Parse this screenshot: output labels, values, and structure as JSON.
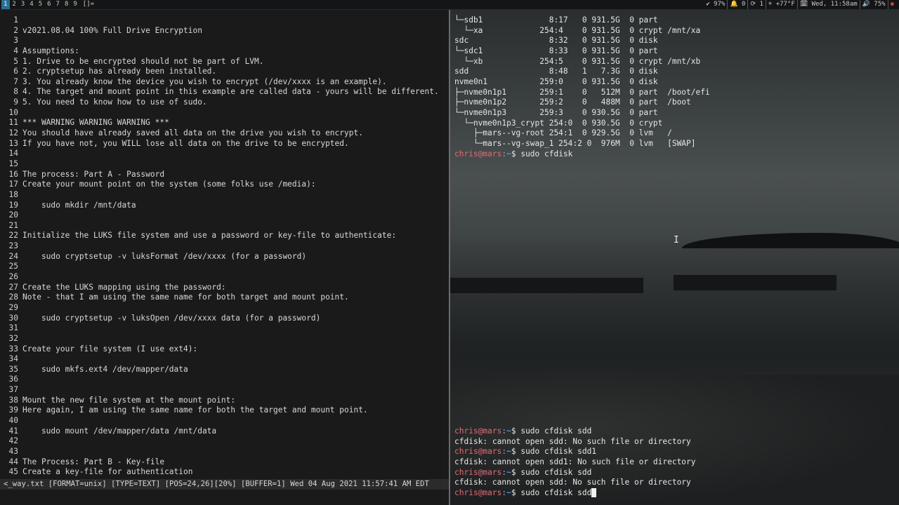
{
  "topbar": {
    "workspaces": [
      {
        "label": "1",
        "active": true
      },
      {
        "label": "2",
        "active": false
      },
      {
        "label": "3",
        "active": false
      },
      {
        "label": "4",
        "active": false
      },
      {
        "label": "5",
        "active": false
      },
      {
        "label": "6",
        "active": false
      },
      {
        "label": "7",
        "active": false
      },
      {
        "label": "8",
        "active": false
      },
      {
        "label": "9",
        "active": false
      }
    ],
    "layout": "[]=",
    "status": {
      "battery_pct": "✔ 97%",
      "notify": "🔔 0",
      "updates": "⟳ 1",
      "weather": "☀ +77°F",
      "datetime": "🗓 Wed, 11:58am",
      "volume": "🔊 75%"
    },
    "red_icon": "◉",
    "accent": "#2c6e8f"
  },
  "vim": {
    "lines": [
      "",
      "v2021.08.04 100% Full Drive Encryption",
      "",
      "Assumptions:",
      "1. Drive to be encrypted should not be part of LVM.",
      "2. cryptsetup has already been installed.",
      "3. You already know the device you wish to encrypt (/dev/xxxx is an example).",
      "4. The target and mount point in this example are called data - yours will be different.",
      "5. You need to know how to use of sudo.",
      "",
      "*** WARNING WARNING WARNING ***",
      "You should have already saved all data on the drive you wish to encrypt.",
      "If you have not, you WILL lose all data on the drive to be encrypted.",
      "",
      "",
      "The process: Part A - Password",
      "Create your mount point on the system (some folks use /media):",
      "",
      "    sudo mkdir /mnt/data",
      "",
      "",
      "Initialize the LUKS file system and use a password or key-file to authenticate:",
      "",
      "    sudo cryptsetup -v luksFormat /dev/xxxx (for a password)",
      "",
      "",
      "Create the LUKS mapping using the password:",
      "Note - that I am using the same name for both target and mount point.",
      "",
      "    sudo cryptsetup -v luksOpen /dev/xxxx data (for a password)",
      "",
      "",
      "Create your file system (I use ext4):",
      "",
      "    sudo mkfs.ext4 /dev/mapper/data",
      "",
      "",
      "Mount the new file system at the mount point:",
      "Here again, I am using the same name for both the target and mount point.",
      "",
      "    sudo mount /dev/mapper/data /mnt/data",
      "",
      "",
      "The Process: Part B - Key-file",
      "Create a key-file for authentication"
    ],
    "status_line": "<_way.txt [FORMAT=unix] [TYPE=TEXT] [POS=24,26][20%] [BUFFER=1] Wed 04 Aug 2021 11:57:41 AM EDT"
  },
  "terminal": {
    "prompt_user": "chris@mars",
    "prompt_path": ":~",
    "prompt_symbol": "$",
    "lsblk_rows": [
      "└─sdb1              8:17   0 931.5G  0 part",
      "  └─xa            254:4    0 931.5G  0 crypt /mnt/xa",
      "sdc                 8:32   0 931.5G  0 disk",
      "└─sdc1              8:33   0 931.5G  0 part",
      "  └─xb            254:5    0 931.5G  0 crypt /mnt/xb",
      "sdd                 8:48   1   7.3G  0 disk",
      "nvme0n1           259:0    0 931.5G  0 disk",
      "├─nvme0n1p1       259:1    0   512M  0 part  /boot/efi",
      "├─nvme0n1p2       259:2    0   488M  0 part  /boot",
      "└─nvme0n1p3       259:3    0 930.5G  0 part",
      "  └─nvme0n1p3_crypt 254:0  0 930.5G  0 crypt",
      "    ├─mars--vg-root 254:1  0 929.5G  0 lvm   /",
      "    └─mars--vg-swap_1 254:2 0  976M  0 lvm   [SWAP]"
    ],
    "top_cmd": " sudo cfdisk",
    "history": [
      {
        "type": "prompt",
        "cmd": " sudo cfdisk sdd"
      },
      {
        "type": "out",
        "text": "cfdisk: cannot open sdd: No such file or directory"
      },
      {
        "type": "prompt",
        "cmd": " sudo cfdisk sdd1"
      },
      {
        "type": "out",
        "text": "cfdisk: cannot open sdd1: No such file or directory"
      },
      {
        "type": "prompt",
        "cmd": " sudo cfdisk sdd"
      },
      {
        "type": "out",
        "text": "cfdisk: cannot open sdd: No such file or directory"
      }
    ],
    "current_cmd": " sudo cfdisk sdd",
    "colors": {
      "user": "#e06c75",
      "path": "#7fb0ff"
    }
  }
}
